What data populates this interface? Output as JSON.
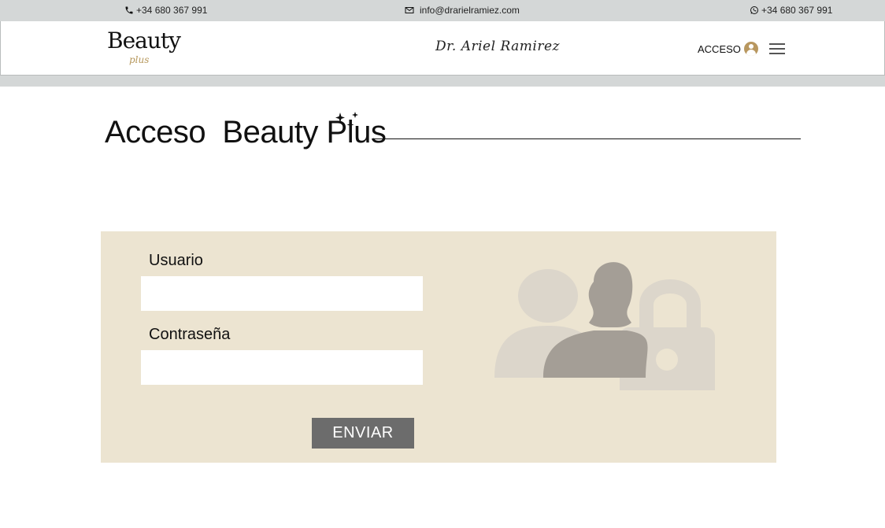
{
  "topbar": {
    "phone_left": "+34 680 367 991",
    "email": "info@drarielramiez.com",
    "whatsapp": "+34 680 367 991"
  },
  "header": {
    "logo_word": "Beauty",
    "logo_sub": "plus",
    "signature": "Dr. Ariel Ramirez",
    "acceso_label": "ACCESO"
  },
  "page": {
    "title": "Acceso  Beauty Plus"
  },
  "form": {
    "usuario_label": "Usuario",
    "usuario_value": "",
    "password_label": "Contraseña",
    "password_value": "",
    "submit_label": "ENVIAR"
  },
  "colors": {
    "topbar_bg": "#d4d7d7",
    "panel_bg": "#ece4d1",
    "button_bg": "#6c6c6c",
    "gold_accent": "#b8975f"
  },
  "icons": [
    "phone-icon",
    "mail-icon",
    "whatsapp-icon",
    "user-circle-icon",
    "hamburger-menu-icon",
    "sparkle-icon",
    "users-lock-illustration"
  ]
}
